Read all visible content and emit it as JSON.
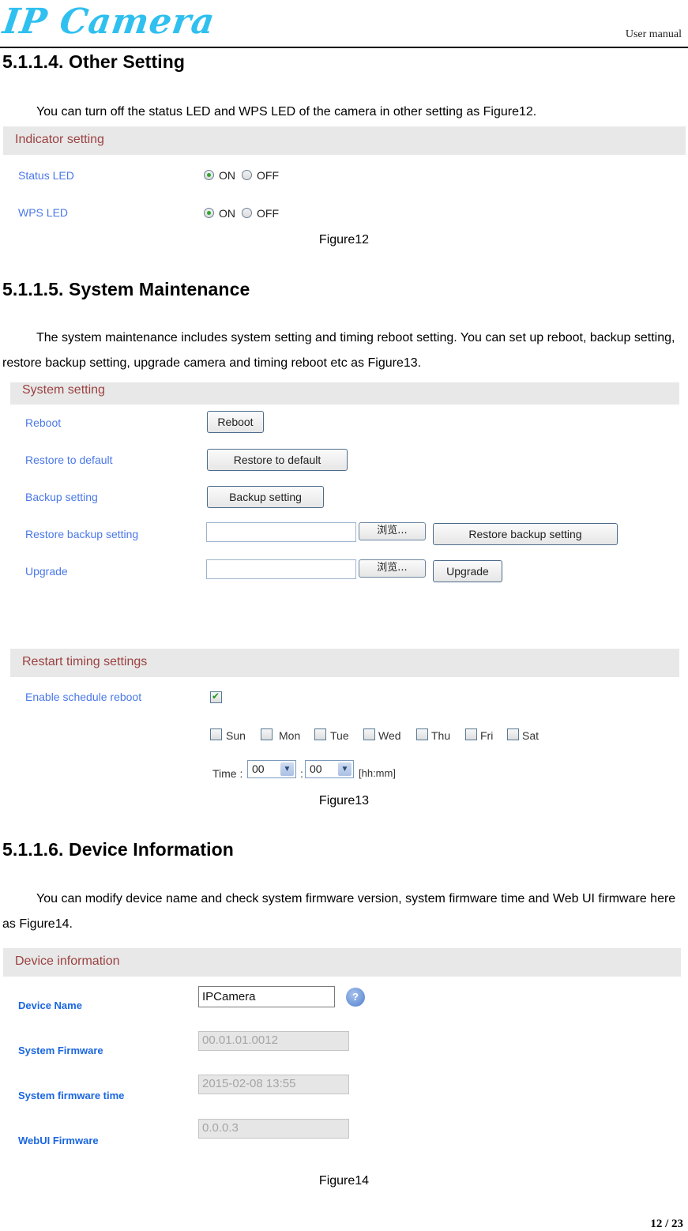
{
  "header": {
    "logo_text": "IP Camera",
    "right_label": "User manual"
  },
  "sections": [
    {
      "heading": "5.1.1.4. Other Setting",
      "paragraph": "You can turn off the status LED and WPS LED of the camera in other setting as Figure12.",
      "caption": "Figure12"
    },
    {
      "heading": "5.1.1.5. System Maintenance",
      "paragraph": "The system maintenance includes system setting and timing reboot setting. You can set up reboot, backup setting, restore backup setting, upgrade camera and timing reboot etc as Figure13.",
      "caption": "Figure13"
    },
    {
      "heading": "5.1.1.6. Device Information",
      "paragraph": "You can modify device name and check system firmware version, system firmware time and Web UI firmware here as Figure14.",
      "caption": "Figure14"
    }
  ],
  "figure12": {
    "title": "Indicator setting",
    "rows": [
      {
        "label": "Status LED",
        "on_label": "ON",
        "off_label": "OFF",
        "selected": "ON"
      },
      {
        "label": "WPS LED",
        "on_label": "ON",
        "off_label": "OFF",
        "selected": "ON"
      }
    ]
  },
  "figure13": {
    "system_title": "System setting",
    "rows": [
      {
        "label": "Reboot",
        "button": "Reboot"
      },
      {
        "label": "Restore to default",
        "button": "Restore to default"
      },
      {
        "label": "Backup setting",
        "button": "Backup setting"
      },
      {
        "label": "Restore backup setting",
        "file_value": "",
        "browse": "浏览...",
        "button": "Restore backup setting"
      },
      {
        "label": "Upgrade",
        "file_value": "",
        "browse": "浏览...",
        "button": "Upgrade"
      }
    ],
    "restart_title": "Restart timing settings",
    "enable_label": "Enable schedule reboot",
    "enable_checked": true,
    "days": [
      {
        "label": "Sun",
        "checked": false
      },
      {
        "label": "Mon",
        "checked": false
      },
      {
        "label": "Tue",
        "checked": false
      },
      {
        "label": "Wed",
        "checked": false
      },
      {
        "label": "Thu",
        "checked": false
      },
      {
        "label": "Fri",
        "checked": false
      },
      {
        "label": "Sat",
        "checked": false
      }
    ],
    "time_label": "Time :",
    "hour": "00",
    "separator": ":",
    "minute": "00",
    "format_hint": "[hh:mm]"
  },
  "figure14": {
    "title": "Device information",
    "device_name_label": "Device Name",
    "device_name_value": "IPCamera",
    "help_icon": "?",
    "rows": [
      {
        "label": "System Firmware",
        "value": "00.01.01.0012"
      },
      {
        "label": "System firmware time",
        "value": "2015-02-08 13:55"
      },
      {
        "label": "WebUI Firmware",
        "value": "0.0.0.3"
      }
    ]
  },
  "footer": {
    "page": "12 / 23"
  }
}
